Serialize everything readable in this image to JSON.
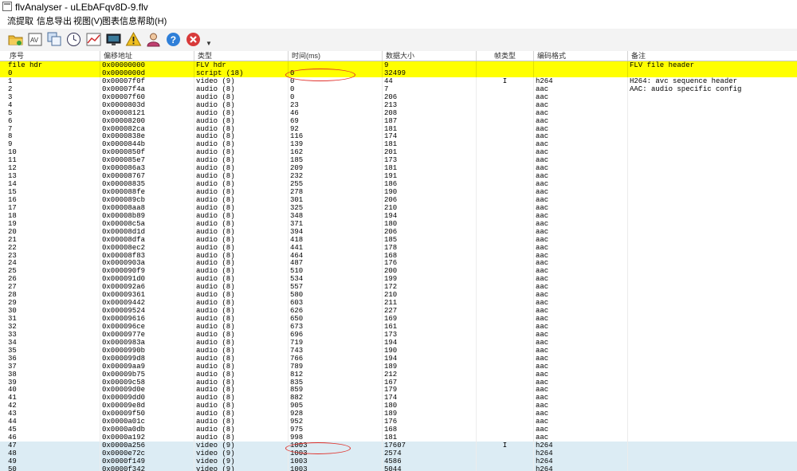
{
  "window": {
    "title": "flvAnalyser - uLEbAFqv8D-9.flv"
  },
  "menu": [
    "流提取",
    "信息导出",
    "视图(V)",
    "图表信息",
    "帮助(H)"
  ],
  "toolbar": {
    "icons": [
      "open-folder-icon",
      "av-icon",
      "copy-windows-icon",
      "clock-icon",
      "line-chart-icon",
      "monitor-icon",
      "warning-icon",
      "user-icon",
      "help-icon",
      "close-icon"
    ]
  },
  "table": {
    "columns": [
      "序号",
      "偏移地址",
      "类型",
      "时间(ms)",
      "数据大小",
      "帧类型",
      "编码格式",
      "备注"
    ],
    "rows": [
      [
        "file hdr",
        "0x00000000",
        "FLV hdr",
        "",
        "9",
        "",
        "",
        "FLV file header"
      ],
      [
        "0",
        "0x0000000d",
        "script (18)",
        "0",
        "32499",
        "",
        "",
        ""
      ],
      [
        "1",
        "0x00007f0f",
        "video (9)",
        "0",
        "44",
        "I",
        "h264",
        "H264: avc sequence header"
      ],
      [
        "2",
        "0x00007f4a",
        "audio (8)",
        "0",
        "7",
        "",
        "aac",
        "AAC: audio specific config"
      ],
      [
        "3",
        "0x00007f60",
        "audio (8)",
        "0",
        "206",
        "",
        "aac",
        ""
      ],
      [
        "4",
        "0x0000803d",
        "audio (8)",
        "23",
        "213",
        "",
        "aac",
        ""
      ],
      [
        "5",
        "0x00008121",
        "audio (8)",
        "46",
        "208",
        "",
        "aac",
        ""
      ],
      [
        "6",
        "0x00008200",
        "audio (8)",
        "69",
        "187",
        "",
        "aac",
        ""
      ],
      [
        "7",
        "0x000082ca",
        "audio (8)",
        "92",
        "181",
        "",
        "aac",
        ""
      ],
      [
        "8",
        "0x0000838e",
        "audio (8)",
        "116",
        "174",
        "",
        "aac",
        ""
      ],
      [
        "9",
        "0x0000844b",
        "audio (8)",
        "139",
        "181",
        "",
        "aac",
        ""
      ],
      [
        "10",
        "0x0000850f",
        "audio (8)",
        "162",
        "201",
        "",
        "aac",
        ""
      ],
      [
        "11",
        "0x000085e7",
        "audio (8)",
        "185",
        "173",
        "",
        "aac",
        ""
      ],
      [
        "12",
        "0x000086a3",
        "audio (8)",
        "209",
        "181",
        "",
        "aac",
        ""
      ],
      [
        "13",
        "0x00008767",
        "audio (8)",
        "232",
        "191",
        "",
        "aac",
        ""
      ],
      [
        "14",
        "0x00008835",
        "audio (8)",
        "255",
        "186",
        "",
        "aac",
        ""
      ],
      [
        "15",
        "0x000088fe",
        "audio (8)",
        "278",
        "190",
        "",
        "aac",
        ""
      ],
      [
        "16",
        "0x000089cb",
        "audio (8)",
        "301",
        "206",
        "",
        "aac",
        ""
      ],
      [
        "17",
        "0x00008aa8",
        "audio (8)",
        "325",
        "210",
        "",
        "aac",
        ""
      ],
      [
        "18",
        "0x00008b89",
        "audio (8)",
        "348",
        "194",
        "",
        "aac",
        ""
      ],
      [
        "19",
        "0x00008c5a",
        "audio (8)",
        "371",
        "180",
        "",
        "aac",
        ""
      ],
      [
        "20",
        "0x00008d1d",
        "audio (8)",
        "394",
        "206",
        "",
        "aac",
        ""
      ],
      [
        "21",
        "0x00008dfa",
        "audio (8)",
        "418",
        "185",
        "",
        "aac",
        ""
      ],
      [
        "22",
        "0x00008ec2",
        "audio (8)",
        "441",
        "178",
        "",
        "aac",
        ""
      ],
      [
        "23",
        "0x00008f83",
        "audio (8)",
        "464",
        "168",
        "",
        "aac",
        ""
      ],
      [
        "24",
        "0x0000903a",
        "audio (8)",
        "487",
        "176",
        "",
        "aac",
        ""
      ],
      [
        "25",
        "0x000090f9",
        "audio (8)",
        "510",
        "200",
        "",
        "aac",
        ""
      ],
      [
        "26",
        "0x000091d0",
        "audio (8)",
        "534",
        "199",
        "",
        "aac",
        ""
      ],
      [
        "27",
        "0x000092a6",
        "audio (8)",
        "557",
        "172",
        "",
        "aac",
        ""
      ],
      [
        "28",
        "0x00009361",
        "audio (8)",
        "580",
        "210",
        "",
        "aac",
        ""
      ],
      [
        "29",
        "0x00009442",
        "audio (8)",
        "603",
        "211",
        "",
        "aac",
        ""
      ],
      [
        "30",
        "0x00009524",
        "audio (8)",
        "626",
        "227",
        "",
        "aac",
        ""
      ],
      [
        "31",
        "0x00009616",
        "audio (8)",
        "650",
        "169",
        "",
        "aac",
        ""
      ],
      [
        "32",
        "0x000096ce",
        "audio (8)",
        "673",
        "161",
        "",
        "aac",
        ""
      ],
      [
        "33",
        "0x0000977e",
        "audio (8)",
        "696",
        "173",
        "",
        "aac",
        ""
      ],
      [
        "34",
        "0x0000983a",
        "audio (8)",
        "719",
        "194",
        "",
        "aac",
        ""
      ],
      [
        "35",
        "0x0000990b",
        "audio (8)",
        "743",
        "190",
        "",
        "aac",
        ""
      ],
      [
        "36",
        "0x000099d8",
        "audio (8)",
        "766",
        "194",
        "",
        "aac",
        ""
      ],
      [
        "37",
        "0x00009aa9",
        "audio (8)",
        "789",
        "189",
        "",
        "aac",
        ""
      ],
      [
        "38",
        "0x00009b75",
        "audio (8)",
        "812",
        "212",
        "",
        "aac",
        ""
      ],
      [
        "39",
        "0x00009c58",
        "audio (8)",
        "835",
        "167",
        "",
        "aac",
        ""
      ],
      [
        "40",
        "0x00009d0e",
        "audio (8)",
        "859",
        "179",
        "",
        "aac",
        ""
      ],
      [
        "41",
        "0x00009dd0",
        "audio (8)",
        "882",
        "174",
        "",
        "aac",
        ""
      ],
      [
        "42",
        "0x00009e8d",
        "audio (8)",
        "905",
        "180",
        "",
        "aac",
        ""
      ],
      [
        "43",
        "0x00009f50",
        "audio (8)",
        "928",
        "189",
        "",
        "aac",
        ""
      ],
      [
        "44",
        "0x0000a01c",
        "audio (8)",
        "952",
        "176",
        "",
        "aac",
        ""
      ],
      [
        "45",
        "0x0000a0db",
        "audio (8)",
        "975",
        "168",
        "",
        "aac",
        ""
      ],
      [
        "46",
        "0x0000a192",
        "audio (8)",
        "998",
        "181",
        "",
        "aac",
        ""
      ],
      [
        "47",
        "0x0000a256",
        "video (9)",
        "1003",
        "17607",
        "I",
        "h264",
        ""
      ],
      [
        "48",
        "0x0000e72c",
        "video (9)",
        "1003",
        "2574",
        "",
        "h264",
        ""
      ],
      [
        "49",
        "0x0000f149",
        "video (9)",
        "1003",
        "4586",
        "",
        "h264",
        ""
      ],
      [
        "50",
        "0x0000f342",
        "video (9)",
        "1003",
        "5044",
        "",
        "h264",
        ""
      ]
    ],
    "highlight": {
      "yellow_rows": [
        "file hdr",
        "0"
      ],
      "blue_rows": [
        "47",
        "48",
        "49",
        "50"
      ]
    },
    "colors": {
      "yellow": "#ffff00",
      "blue": "#dcecf4",
      "annotation_oval": "#e0302a"
    }
  }
}
